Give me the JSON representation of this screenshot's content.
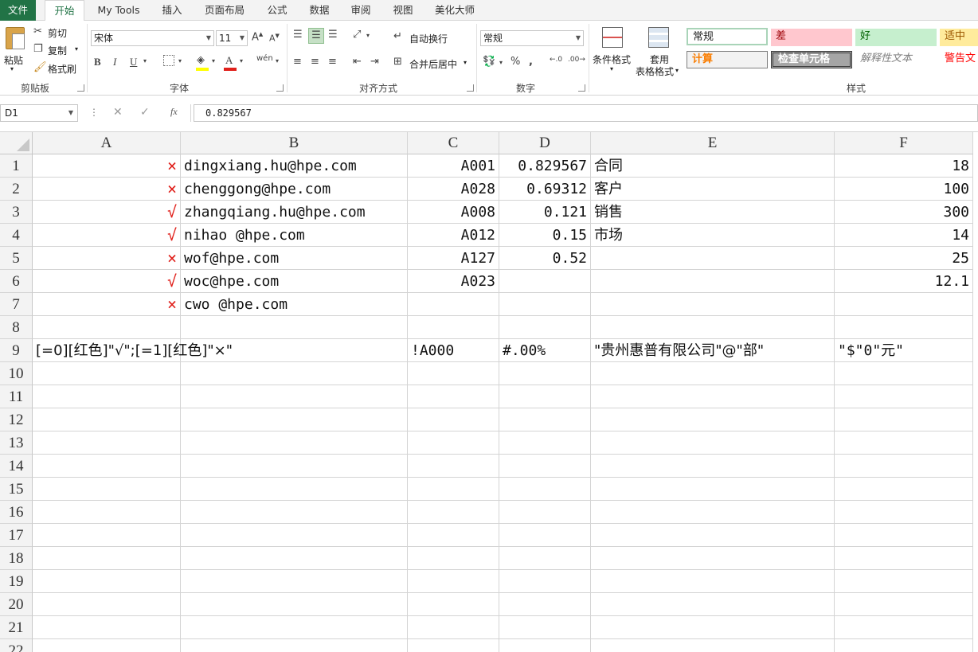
{
  "tabs": [
    "文件",
    "开始",
    "My Tools",
    "插入",
    "页面布局",
    "公式",
    "数据",
    "审阅",
    "视图",
    "美化大师"
  ],
  "clipboard": {
    "paste": "粘贴",
    "cut": "剪切",
    "copy": "复制",
    "format_painter": "格式刷",
    "label": "剪贴板"
  },
  "font": {
    "name": "宋体",
    "size": "11",
    "label": "字体",
    "bold": "B",
    "italic": "I",
    "underline": "U"
  },
  "alignment": {
    "wrap": "自动换行",
    "merge": "合并后居中",
    "label": "对齐方式"
  },
  "number": {
    "format": "常规",
    "label": "数字",
    "percent": "%"
  },
  "styles": {
    "conditional": "条件格式",
    "table_line1": "套用",
    "table_line2": "表格格式",
    "label": "样式",
    "normal": "常规",
    "bad": "差",
    "good": "好",
    "neutral": "适中",
    "calc": "计算",
    "check": "检查单元格",
    "explain": "解释性文本",
    "warn": "警告文"
  },
  "formula_bar": {
    "name_box": "D1",
    "formula": "0.829567"
  },
  "columns": [
    "A",
    "B",
    "C",
    "D",
    "E",
    "F"
  ],
  "rows": [
    "1",
    "2",
    "3",
    "4",
    "5",
    "6",
    "7",
    "8",
    "9",
    "10",
    "11",
    "12",
    "13",
    "14",
    "15",
    "16",
    "17",
    "18",
    "19",
    "20",
    "21",
    "22"
  ],
  "cells": {
    "A": [
      "×",
      "×",
      "√",
      "√",
      "×",
      "√",
      "×",
      "",
      "[=0][红色]\"√\";[=1][红色]\"×\""
    ],
    "B": [
      "dingxiang.hu@hpe.com",
      "chenggong@hpe.com",
      "zhangqiang.hu@hpe.com",
      "nihao @hpe.com",
      "wof@hpe.com",
      "woc@hpe.com",
      "cwo @hpe.com",
      "",
      ""
    ],
    "C": [
      "A001",
      "A028",
      "A008",
      "A012",
      "A127",
      "A023",
      "",
      "",
      "!A000"
    ],
    "D": [
      "0.829567",
      "0.69312",
      "0.121",
      "0.15",
      "0.52",
      "",
      "",
      "",
      "#.00%"
    ],
    "E": [
      "合同",
      "客户",
      "销售",
      "市场",
      "",
      "",
      "",
      "",
      "\"贵州惠普有限公司\"@\"部\""
    ],
    "F": [
      "18",
      "100",
      "300",
      "14",
      "25",
      "12.1",
      "",
      "",
      "\"$\"0\"元\""
    ]
  },
  "colors": {
    "accent": "#217346",
    "mark": "#e0201b"
  }
}
